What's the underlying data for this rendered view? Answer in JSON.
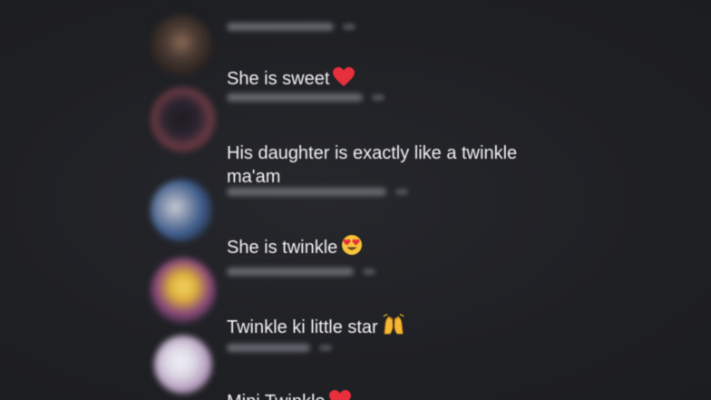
{
  "comments": [
    {
      "text": "She is sweet",
      "emoji_icon": "red-heart-icon",
      "avatar_colors": [
        "#2b2320",
        "#8a6a55",
        "#3a2e2a"
      ]
    },
    {
      "text": "His daughter is exactly like a twinkle\nma'am",
      "emoji_icon": "",
      "avatar_colors": [
        "#3a2630",
        "#6a3a44",
        "#222027"
      ]
    },
    {
      "text": "She is twinkle",
      "emoji_icon": "heart-eyes-face-icon",
      "avatar_colors": [
        "#c8cbd4",
        "#3b5a8a",
        "#2a3345"
      ]
    },
    {
      "text": "Twinkle ki little star",
      "emoji_icon": "raising-hands-icon",
      "avatar_colors": [
        "#e0b43a",
        "#8a4a7a",
        "#3c2a44"
      ]
    },
    {
      "text": "Mini Twinkle",
      "emoji_icon": "red-heart-icon",
      "avatar_colors": [
        "#dedbe6",
        "#b8a0c0",
        "#6a5a74"
      ]
    }
  ]
}
